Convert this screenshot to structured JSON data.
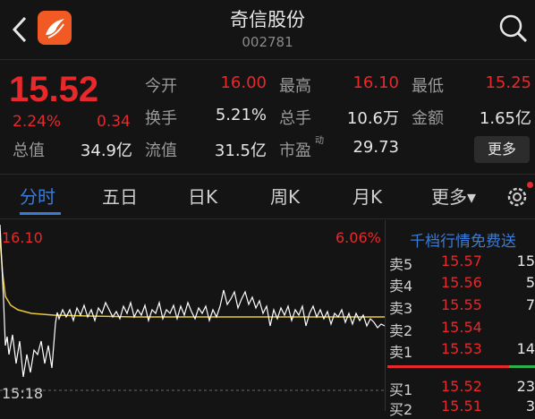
{
  "header": {
    "title": "奇信股份",
    "code": "002781"
  },
  "quote": {
    "price": "15.52",
    "change_pct": "2.24%",
    "change": "0.34",
    "stats": [
      {
        "label": "今开",
        "value": "16.00",
        "color": "red"
      },
      {
        "label": "最高",
        "value": "16.10",
        "color": "red"
      },
      {
        "label": "最低",
        "value": "15.25",
        "color": "red"
      },
      {
        "label": "换手",
        "value": "5.21%"
      },
      {
        "label": "总手",
        "value": "10.6万"
      },
      {
        "label": "金额",
        "value": "1.65亿"
      },
      {
        "label": "总值",
        "value": "34.9亿"
      },
      {
        "label": "流值",
        "value": "31.5亿"
      },
      {
        "label": "市盈",
        "value": "29.73"
      }
    ],
    "pe_superscript": "动",
    "more_label": "更多"
  },
  "tabs": [
    {
      "label": "分时",
      "active": true
    },
    {
      "label": "五日"
    },
    {
      "label": "日K"
    },
    {
      "label": "周K"
    },
    {
      "label": "月K"
    },
    {
      "label": "更多▾"
    }
  ],
  "chart": {
    "high_label": "16.10",
    "high_pct": "6.06%",
    "time_label": "15:18"
  },
  "orderbook": {
    "title": "千档行情免费送",
    "asks": [
      {
        "name": "卖5",
        "price": "15.57",
        "vol": "15"
      },
      {
        "name": "卖4",
        "price": "15.56",
        "vol": "5"
      },
      {
        "name": "卖3",
        "price": "15.55",
        "vol": "7"
      },
      {
        "name": "卖2",
        "price": "15.54",
        "vol": ""
      },
      {
        "name": "卖1",
        "price": "15.53",
        "vol": "14"
      }
    ],
    "bids": [
      {
        "name": "买1",
        "price": "15.52",
        "vol": "23"
      },
      {
        "name": "买2",
        "price": "15.51",
        "vol": "3"
      }
    ]
  },
  "colors": {
    "up": "#e8282b",
    "down": "#2bb34b",
    "accent": "#3a7bd5",
    "bg": "#141414"
  },
  "icons": {
    "back": "chevron-left-icon",
    "logo": "app-logo-icon",
    "search": "search-icon",
    "settings": "gear-icon"
  }
}
